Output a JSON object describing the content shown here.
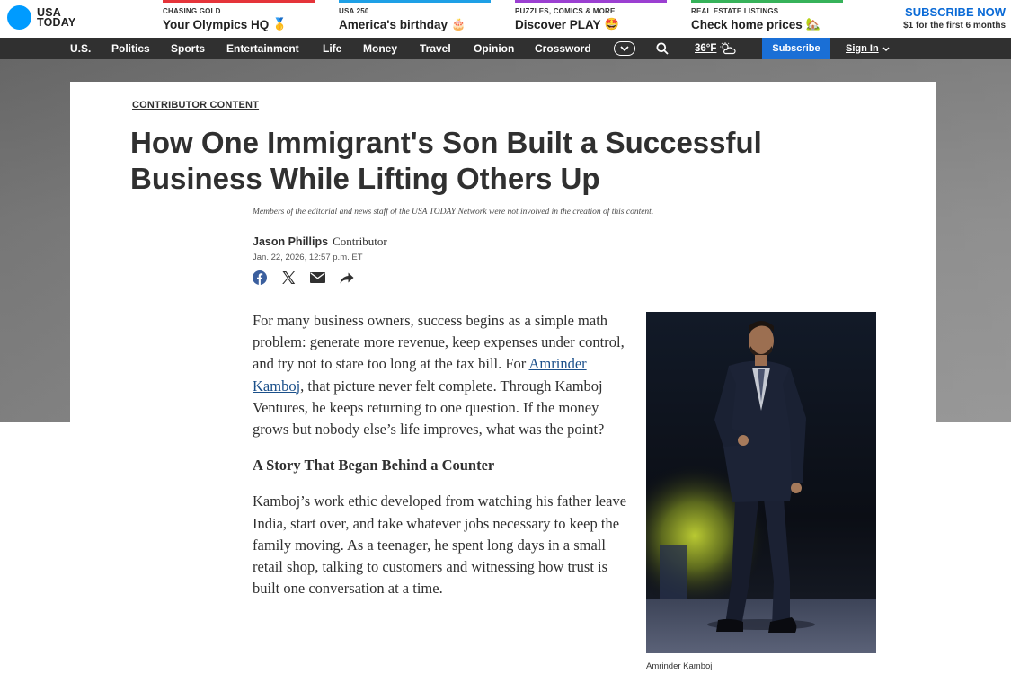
{
  "logo": {
    "line1": "USA",
    "line2": "TODAY",
    "accent": "#009bff"
  },
  "promos": [
    {
      "kicker": "CHASING GOLD",
      "title": "Your Olympics HQ",
      "emoji": "🥇",
      "color": "#e5343a"
    },
    {
      "kicker": "USA 250",
      "title": "America's birthday",
      "emoji": "🎂",
      "color": "#1ea0e6"
    },
    {
      "kicker": "PUZZLES, COMICS & MORE",
      "title": "Discover PLAY",
      "emoji": "🤩",
      "color": "#9b3fd1"
    },
    {
      "kicker": "REAL ESTATE LISTINGS",
      "title": "Check home prices",
      "emoji": "🏡",
      "color": "#36b25a"
    }
  ],
  "subscribe_promo": {
    "title": "SUBSCRIBE NOW",
    "subtitle": "$1 for the first 6 months"
  },
  "nav": {
    "items": [
      "U.S.",
      "Politics",
      "Sports",
      "Entertainment",
      "Life",
      "Money",
      "Travel",
      "Opinion",
      "Crossword"
    ],
    "weather": "36°F",
    "subscribe": "Subscribe",
    "signin": "Sign In"
  },
  "article": {
    "eyebrow": "CONTRIBUTOR CONTENT",
    "headline": "How One Immigrant's Son Built a Successful Business While Lifting Others Up",
    "disclaimer": "Members of the editorial and news staff of the USA TODAY Network were not involved in the creation of this content.",
    "author": "Jason Phillips",
    "role": "Contributor",
    "date": "Jan. 22, 2026, 12:57 p.m. ET",
    "p1_before": "For many business owners, success begins as a simple math problem: generate more revenue, keep expenses under control, and try not to stare too long at the tax bill. For ",
    "p1_link": "Amrinder Kamboj",
    "p1_after": ", that picture never felt complete. Through Kamboj Ventures, he keeps returning to one question. If the money grows but nobody else’s life improves, what was the point?",
    "subhead": "A Story That Began Behind a Counter",
    "p2": "Kamboj’s work ethic developed from watching his father leave India, start over, and take whatever jobs necessary to keep the family moving. As a teenager, he spent long days in a small retail shop, talking to customers and witnessing how trust is built one conversation at a time.",
    "caption": "Amrinder Kamboj"
  }
}
